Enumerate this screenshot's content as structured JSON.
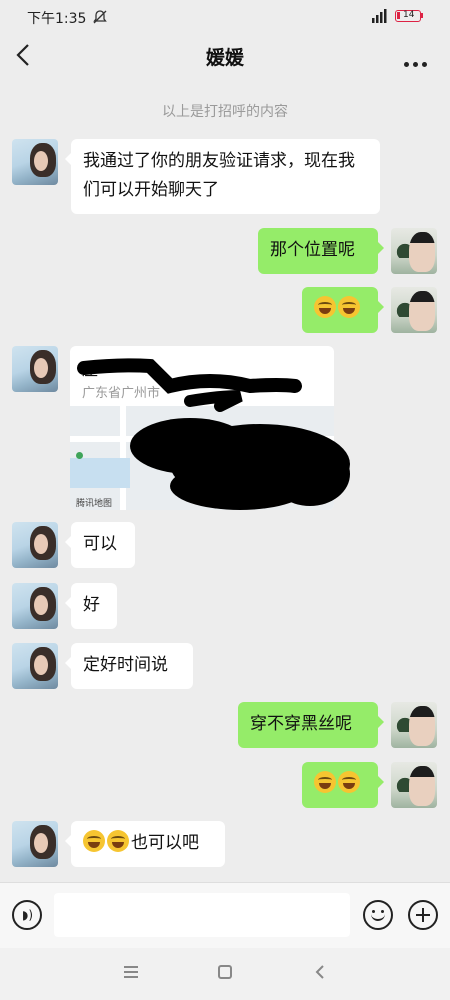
{
  "status_bar": {
    "time": "下午1:35",
    "battery": "14"
  },
  "header": {
    "title": "媛媛"
  },
  "system_note": "以上是打招呼的内容",
  "messages": [
    {
      "side": "left",
      "text": "我通过了你的朋友验证请求，现在我们可以开始聊天了"
    },
    {
      "side": "right",
      "text": "那个位置呢"
    },
    {
      "side": "right",
      "text": ""
    },
    {
      "side": "left",
      "type": "location",
      "name": "座",
      "address": "广东省广州市"
    },
    {
      "side": "left",
      "text": "可以"
    },
    {
      "side": "left",
      "text": "好"
    },
    {
      "side": "left",
      "text": "定好时间说"
    },
    {
      "side": "right",
      "text": "穿不穿黑丝呢"
    },
    {
      "side": "right",
      "text": ""
    },
    {
      "side": "left",
      "text": "也可以吧"
    }
  ],
  "map_label": "腾讯地图",
  "icons": [
    "back-arrow-icon",
    "more-icon",
    "voice-icon",
    "emoji-icon",
    "plus-icon",
    "laugh-cry-emoji"
  ]
}
